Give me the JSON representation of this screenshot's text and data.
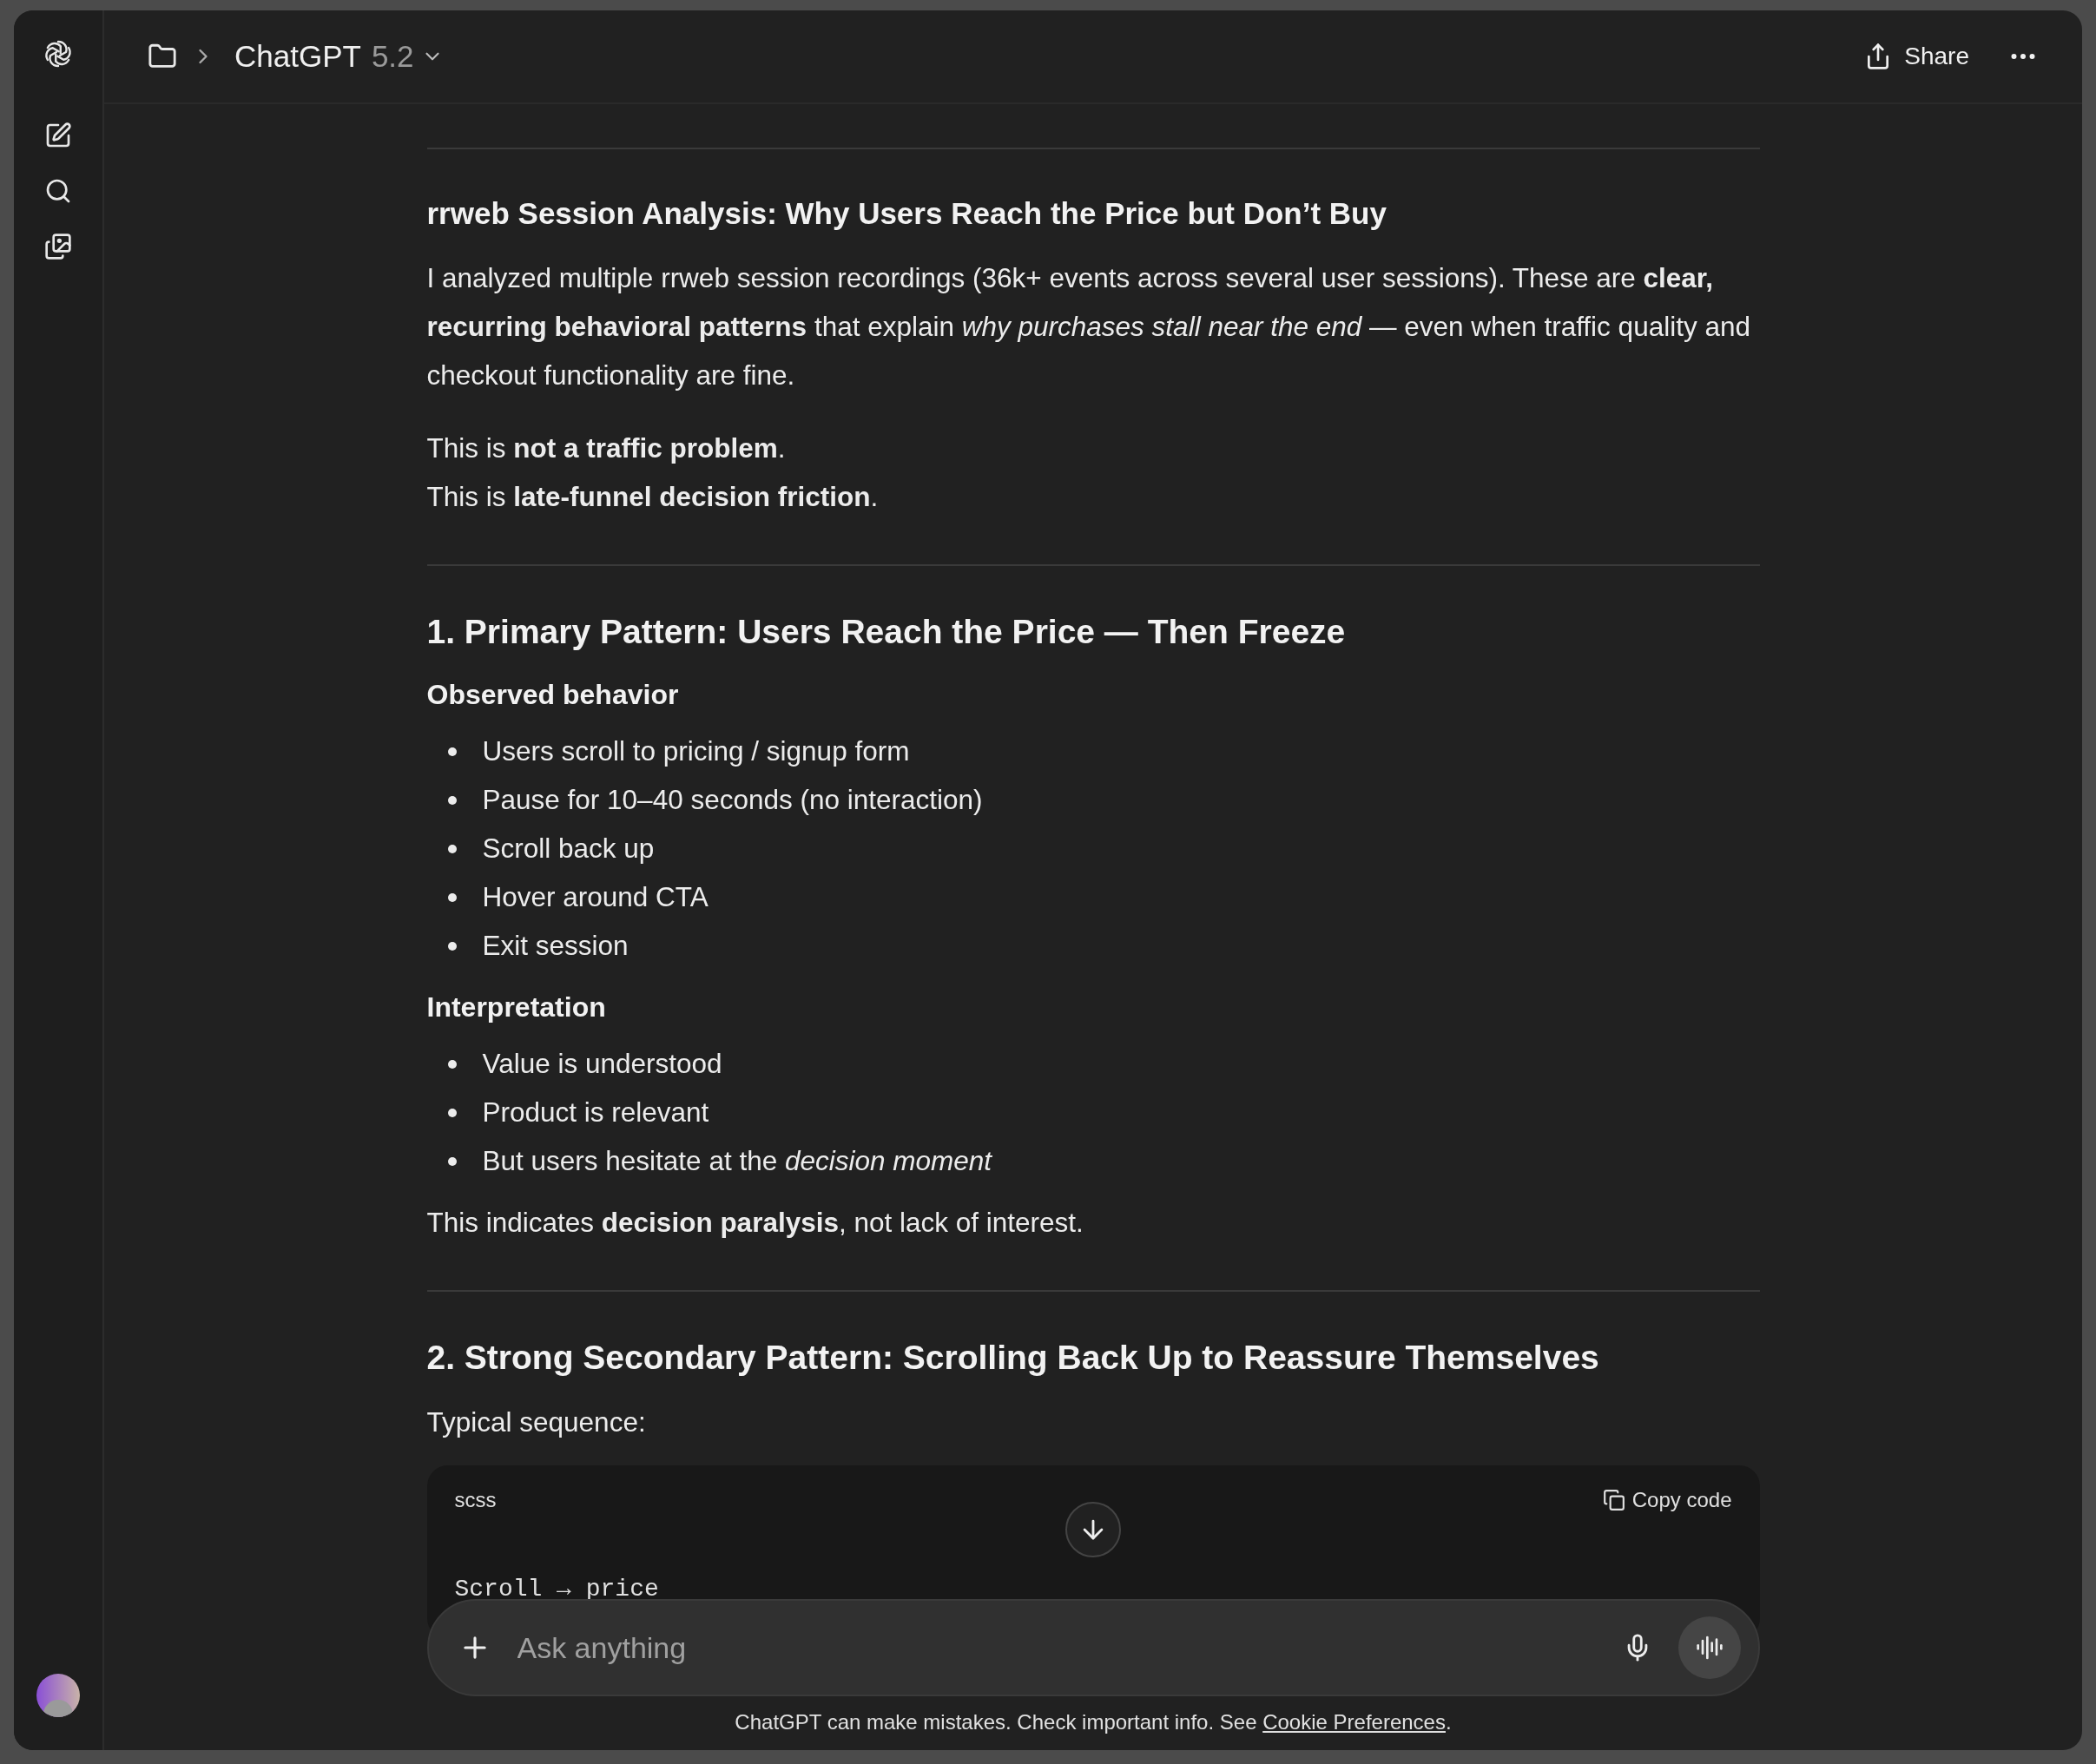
{
  "header": {
    "title": "ChatGPT",
    "model": "5.2",
    "share": "Share"
  },
  "blocks": [
    {
      "kind": "hr"
    },
    {
      "kind": "h3",
      "text": "rrweb Session Analysis: Why Users Reach the Price but Don’t Buy"
    },
    {
      "kind": "p",
      "text": "I analyzed multiple rrweb session recordings (36k+ events across several user sessions). These are **clear, recurring behavioral patterns** that explain *why purchases stall near the end* — even when traffic quality and checkout functionality are fine."
    },
    {
      "kind": "lines",
      "items": [
        "This is **not a traffic problem**.",
        "This is **late-funnel decision friction**."
      ]
    },
    {
      "kind": "hr"
    },
    {
      "kind": "h2",
      "text": "1. Primary Pattern: Users Reach the Price — Then Freeze"
    },
    {
      "kind": "h4",
      "text": "Observed behavior"
    },
    {
      "kind": "ul",
      "items": [
        "Users scroll to pricing / signup form",
        "Pause for 10–40 seconds (no interaction)",
        "Scroll back up",
        "Hover around CTA",
        "Exit session"
      ]
    },
    {
      "kind": "h4",
      "text": "Interpretation"
    },
    {
      "kind": "ul",
      "items": [
        "Value is understood",
        "Product is relevant",
        "But users hesitate at the *decision moment*"
      ]
    },
    {
      "kind": "p",
      "text": "This indicates **decision paralysis**, not lack of interest."
    },
    {
      "kind": "hr"
    },
    {
      "kind": "h2",
      "text": "2. Strong Secondary Pattern: Scrolling Back Up to Reassure Themselves"
    },
    {
      "kind": "p",
      "text": "Typical sequence:"
    },
    {
      "kind": "code",
      "language": "scss",
      "copy": "Copy code",
      "code": "Scroll → price"
    }
  ],
  "composer": {
    "placeholder": "Ask anything"
  },
  "footer": {
    "text": "ChatGPT can make mistakes. Check important info. See",
    "link": "Cookie Preferences",
    "end": "."
  }
}
